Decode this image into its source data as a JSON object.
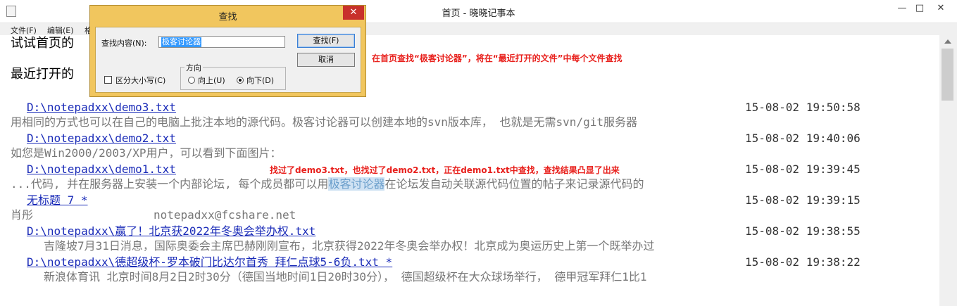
{
  "window": {
    "title": "首页 - 晓晓记事本",
    "min_glyph": "—",
    "max_glyph": "□",
    "close_glyph": "✕"
  },
  "menu": {
    "items": [
      "文件(F)",
      "编辑(E)",
      "格"
    ]
  },
  "editor": {
    "header_line1": "试试首页的",
    "header_line2": "最近打开的",
    "entries": [
      {
        "path": "D:\\notepadxx\\demo3.txt",
        "time": "15-08-02 19:50:58",
        "snippet": "  用相同的方式也可以在自己的电脑上批注本地的源代码。极客讨论器可以创建本地的svn版本库， 也就是无需svn/git服务器"
      },
      {
        "path": "D:\\notepadxx\\demo2.txt",
        "time": "15-08-02 19:40:06",
        "snippet": "如您是Win2000/2003/XP用户，可以看到下面图片："
      },
      {
        "path": "D:\\notepadxx\\demo1.txt",
        "time": "15-08-02 19:39:45",
        "snippet_pre": "...代码, 并在服务器上安装一个内部论坛, 每个成员都可以用",
        "snippet_hl": "极客讨论器",
        "snippet_post": "在论坛发自动关联源代码位置的帖子来记录源代码的"
      },
      {
        "path": "无标题 7 *",
        "time": "15-08-02 19:39:15",
        "snippet_a": "肖彤",
        "snippet_b": "notepadxx@fcshare.net"
      },
      {
        "path": "D:\\notepadxx\\赢了！北京获2022年冬奥会举办权.txt",
        "time": "15-08-02 19:38:55",
        "snippet": "吉隆坡7月31日消息，国际奥委会主席巴赫刚刚宣布，北京获得2022年冬奥会举办权！北京成为奥运历史上第一个既举办过"
      },
      {
        "path": "D:\\notepadxx\\德超级杯-罗本破门比达尔首秀 拜仁点球5-6负.txt *",
        "time": "15-08-02 19:38:22",
        "snippet": "新浪体育讯   北京时间8月2日2时30分（德国当地时间1日20时30分）， 德国超级杯在大众球场举行， 德甲冠军拜仁1比1"
      }
    ]
  },
  "annotations": {
    "top": "在首页查找“极客讨论器”，将在“最近打开的文件”中每个文件查找",
    "middle": "找过了demo3.txt，也找过了demo2.txt，正在demo1.txt中查找，查找结果凸显了出来"
  },
  "find_dialog": {
    "title": "查找",
    "close_glyph": "✕",
    "find_label": "查找内容(N):",
    "find_value": "极客讨论器",
    "find_button": "查找(F)",
    "cancel_button": "取消",
    "case_label": "区分大小写(C)",
    "case_checked": false,
    "direction_label": "方向",
    "up_label": "向上(U)",
    "down_label": "向下(D)",
    "direction_selected": "down"
  },
  "colors": {
    "link": "#1a2bb8",
    "highlight": "#cfe2f3",
    "annotation": "#e8201c",
    "dialog_frame": "#f1c65e",
    "close_red": "#c8312c"
  }
}
